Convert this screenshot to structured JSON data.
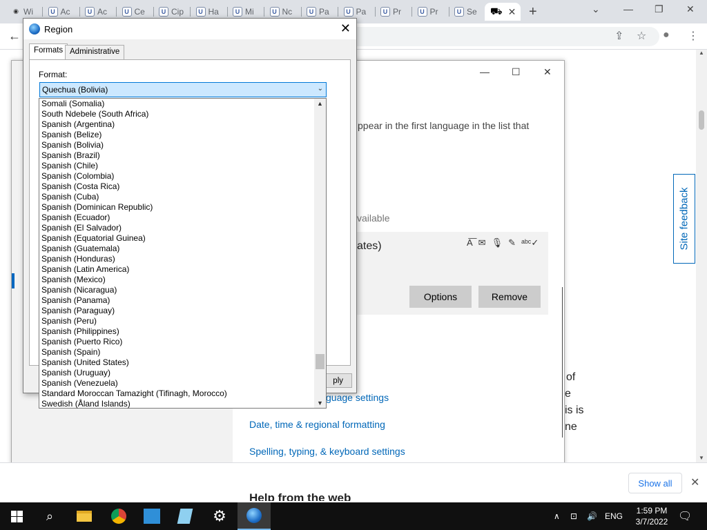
{
  "browser": {
    "tabs": [
      {
        "label": "Wi",
        "icon": "eye-favicon"
      },
      {
        "label": "Ac",
        "icon": "shield-favicon"
      },
      {
        "label": "Ac",
        "icon": "shield-favicon"
      },
      {
        "label": "Ce",
        "icon": "shield-favicon"
      },
      {
        "label": "Cip",
        "icon": "shield-favicon"
      },
      {
        "label": "Ha",
        "icon": "shield-favicon"
      },
      {
        "label": "Mi",
        "icon": "shield-favicon"
      },
      {
        "label": "Nc",
        "icon": "shield-favicon"
      },
      {
        "label": "Pa",
        "icon": "shield-favicon"
      },
      {
        "label": "Pa",
        "icon": "shield-favicon"
      },
      {
        "label": "Pr",
        "icon": "shield-favicon"
      },
      {
        "label": "Pr",
        "icon": "shield-favicon"
      },
      {
        "label": "Se",
        "icon": "shield-favicon"
      }
    ],
    "active_tab_close": "✕",
    "new_tab": "+",
    "window_controls": {
      "dropdown": "⌄",
      "minimize": "—",
      "restore": "❐",
      "close": "✕"
    },
    "toolbar_icons": {
      "back": "←",
      "share": "⇪",
      "star": "☆",
      "profile": "●",
      "menu": "⋮"
    }
  },
  "page": {
    "fragments": {
      "first_language": "ppear in the first language in the list that",
      "available": "vailable",
      "ates": "ates)",
      "of": "of",
      "e": "e",
      "is_is": "is is",
      "ne": "ne",
      "guage_settings": "guage settings"
    },
    "buttons": {
      "options": "Options",
      "remove": "Remove"
    },
    "links": {
      "date_time": "Date, time & regional formatting",
      "spelling": "Spelling, typing, & keyboard settings"
    },
    "feature_icons": [
      "text-icon",
      "speech-bubble-icon",
      "microphone-icon",
      "handwriting-icon",
      "spellcheck-icon"
    ],
    "feature_glyphs": [
      "A͞",
      "✉",
      "🎙",
      "✎",
      "ᵃᵇᶜ✓"
    ],
    "site_feedback": "Site feedback",
    "cut_heading": "Help from the web",
    "settings_controls": {
      "minimize": "—",
      "maximize": "☐",
      "close": "✕"
    },
    "download_bar": {
      "show_all": "Show all",
      "close": "✕"
    }
  },
  "region_dialog": {
    "title": "Region",
    "close": "✕",
    "tabs": [
      {
        "label": "Formats",
        "active": true
      },
      {
        "label": "Administrative",
        "active": false
      }
    ],
    "format_label": "Format:",
    "selected_format": "Quechua (Bolivia)",
    "apply_label": "Apply",
    "apply_visible": "ply",
    "dropdown_items": [
      "Somali (Somalia)",
      "South Ndebele (South Africa)",
      "Spanish (Argentina)",
      "Spanish (Belize)",
      "Spanish (Bolivia)",
      "Spanish (Brazil)",
      "Spanish (Chile)",
      "Spanish (Colombia)",
      "Spanish (Costa Rica)",
      "Spanish (Cuba)",
      "Spanish (Dominican Republic)",
      "Spanish (Ecuador)",
      "Spanish (El Salvador)",
      "Spanish (Equatorial Guinea)",
      "Spanish (Guatemala)",
      "Spanish (Honduras)",
      "Spanish (Latin America)",
      "Spanish (Mexico)",
      "Spanish (Nicaragua)",
      "Spanish (Panama)",
      "Spanish (Paraguay)",
      "Spanish (Peru)",
      "Spanish (Philippines)",
      "Spanish (Puerto Rico)",
      "Spanish (Spain)",
      "Spanish (United States)",
      "Spanish (Uruguay)",
      "Spanish (Venezuela)",
      "Standard Moroccan Tamazight (Tifinagh, Morocco)",
      "Swedish (Åland Islands)"
    ]
  },
  "taskbar": {
    "apps": [
      "start-button",
      "search-icon",
      "file-explorer-icon",
      "chrome-icon",
      "control-panel-icon",
      "notepad-icon",
      "settings-icon",
      "region-icon"
    ],
    "tray": {
      "chevron": "∧",
      "network": "⊡",
      "volume": "🔊",
      "language": "ENG",
      "notification": "🗨"
    },
    "time": "1:59 PM",
    "date": "3/7/2022"
  }
}
